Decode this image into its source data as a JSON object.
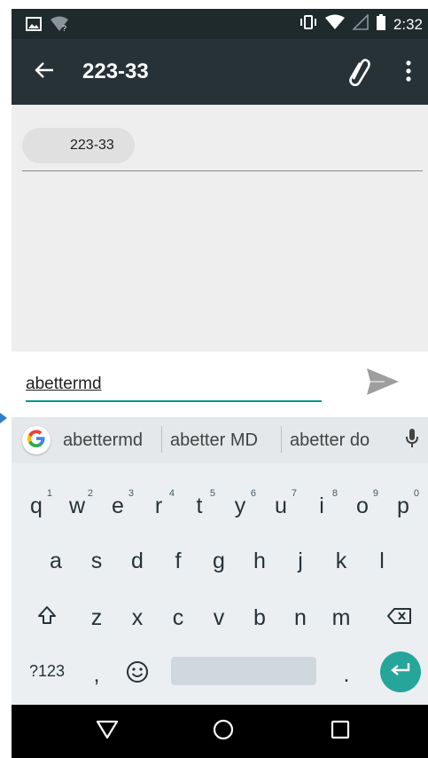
{
  "status_bar": {
    "time": "2:32",
    "icons": [
      "image-notification-icon",
      "wifi-question-icon",
      "vibrate-icon",
      "wifi-signal-icon",
      "cell-signal-icon",
      "battery-icon"
    ]
  },
  "app_bar": {
    "title": "223-33",
    "icons": [
      "back-arrow-icon",
      "paperclip-icon",
      "more-vert-icon"
    ]
  },
  "recipient": {
    "chip_label": "223-33"
  },
  "compose": {
    "message_text": "abettermd",
    "send_icon": "send-icon"
  },
  "keyboard": {
    "suggestions": [
      "abettermd",
      "abetter MD",
      "abetter do"
    ],
    "row1": [
      {
        "key": "q",
        "hint": "1"
      },
      {
        "key": "w",
        "hint": "2"
      },
      {
        "key": "e",
        "hint": "3"
      },
      {
        "key": "r",
        "hint": "4"
      },
      {
        "key": "t",
        "hint": "5"
      },
      {
        "key": "y",
        "hint": "6"
      },
      {
        "key": "u",
        "hint": "7"
      },
      {
        "key": "i",
        "hint": "8"
      },
      {
        "key": "o",
        "hint": "9"
      },
      {
        "key": "p",
        "hint": "0"
      }
    ],
    "row2": [
      "a",
      "s",
      "d",
      "f",
      "g",
      "h",
      "j",
      "k",
      "l"
    ],
    "row3": [
      "z",
      "x",
      "c",
      "v",
      "b",
      "n",
      "m"
    ],
    "symbols_label": "?123",
    "comma": ",",
    "period": ".",
    "accent_color": "#26a69a"
  },
  "nav_bar": {
    "icons": [
      "back-triangle-icon",
      "home-circle-icon",
      "recents-square-icon"
    ]
  },
  "colors": {
    "status_bar": "#1f2a2d",
    "app_bar": "#263238",
    "accent": "#009688",
    "background": "#eeeeee"
  }
}
